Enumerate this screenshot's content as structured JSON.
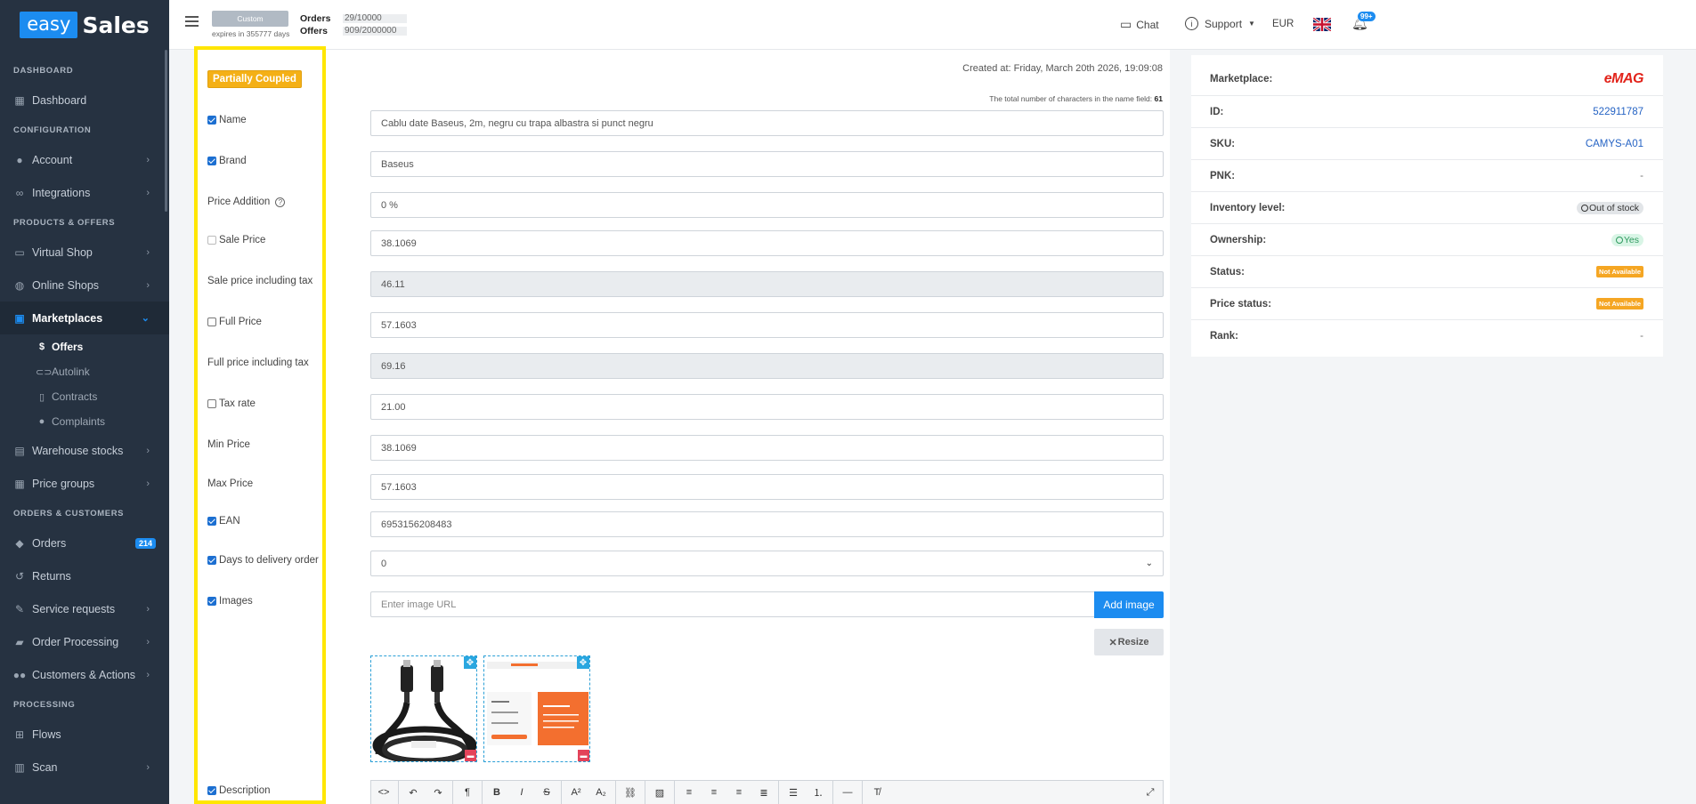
{
  "app": {
    "logo_easy": "easy",
    "logo_sales": "Sales"
  },
  "sidebar": {
    "sections": {
      "dashboard": "DASHBOARD",
      "configuration": "CONFIGURATION",
      "products": "PRODUCTS & OFFERS",
      "orders": "ORDERS & CUSTOMERS",
      "processing": "PROCESSING"
    },
    "items": {
      "dashboard": "Dashboard",
      "account": "Account",
      "integrations": "Integrations",
      "virtual_shop": "Virtual Shop",
      "online_shops": "Online Shops",
      "marketplaces": "Marketplaces",
      "offers": "Offers",
      "autolink": "Autolink",
      "contracts": "Contracts",
      "complaints": "Complaints",
      "warehouse_stocks": "Warehouse stocks",
      "price_groups": "Price groups",
      "orders": "Orders",
      "orders_count": "214",
      "returns": "Returns",
      "service_requests": "Service requests",
      "order_processing": "Order Processing",
      "customers_actions": "Customers & Actions",
      "flows": "Flows",
      "scan": "Scan"
    }
  },
  "topbar": {
    "plan_label": "Custom",
    "plan_expires": "expires in 355777 days",
    "orders_label": "Orders",
    "orders_value": "29/10000",
    "offers_label": "Offers",
    "offers_value": "909/2000000",
    "chat": "Chat",
    "support": "Support",
    "currency": "EUR",
    "notifications": "99+"
  },
  "form": {
    "status_badge": "Partially Coupled",
    "created_at": "Created at: Friday, March 20th 2026, 19:09:08",
    "total_chars_label": "The total number of characters in the name field:",
    "total_chars_value": "61",
    "fields": {
      "name": {
        "label": "Name",
        "value": "Cablu date Baseus, 2m, negru cu trapa albastra si punct negru",
        "checked": true
      },
      "brand": {
        "label": "Brand",
        "value": "Baseus",
        "checked": true
      },
      "price_addition": {
        "label": "Price Addition",
        "value": "0 %"
      },
      "sale_price": {
        "label": "Sale Price",
        "value": "38.1069",
        "checked": false
      },
      "sale_price_tax": {
        "label": "Sale price including tax",
        "value": "46.11"
      },
      "full_price": {
        "label": "Full Price",
        "value": "57.1603",
        "checked": false
      },
      "full_price_tax": {
        "label": "Full price including tax",
        "value": "69.16"
      },
      "tax_rate": {
        "label": "Tax rate",
        "value": "21.00",
        "checked": false
      },
      "min_price": {
        "label": "Min Price",
        "value": "38.1069"
      },
      "max_price": {
        "label": "Max Price",
        "value": "57.1603"
      },
      "ean": {
        "label": "EAN",
        "value": "6953156208483",
        "checked": true
      },
      "days_delivery": {
        "label": "Days to delivery order",
        "value": "0",
        "checked": true
      },
      "images": {
        "label": "Images",
        "placeholder": "Enter image URL",
        "checked": true
      },
      "description": {
        "label": "Description",
        "checked": true
      }
    },
    "add_image": "Add image",
    "resize": "Resize"
  },
  "info": {
    "marketplace_label": "Marketplace:",
    "marketplace_logo": "eMAG",
    "id_label": "ID:",
    "id_value": "522911787",
    "sku_label": "SKU:",
    "sku_value": "CAMYS-A01",
    "pnk_label": "PNK:",
    "pnk_value": "-",
    "inventory_label": "Inventory level:",
    "inventory_value": "Out of stock",
    "ownership_label": "Ownership:",
    "ownership_value": "Yes",
    "status_label": "Status:",
    "status_value": "Not Available",
    "price_status_label": "Price status:",
    "price_status_value": "Not Available",
    "rank_label": "Rank:",
    "rank_value": "-"
  },
  "colors": {
    "sidebar_bg": "#263241",
    "accent": "#1c8cf0",
    "highlight": "#ffe600",
    "badge_orange": "#f4b016"
  }
}
